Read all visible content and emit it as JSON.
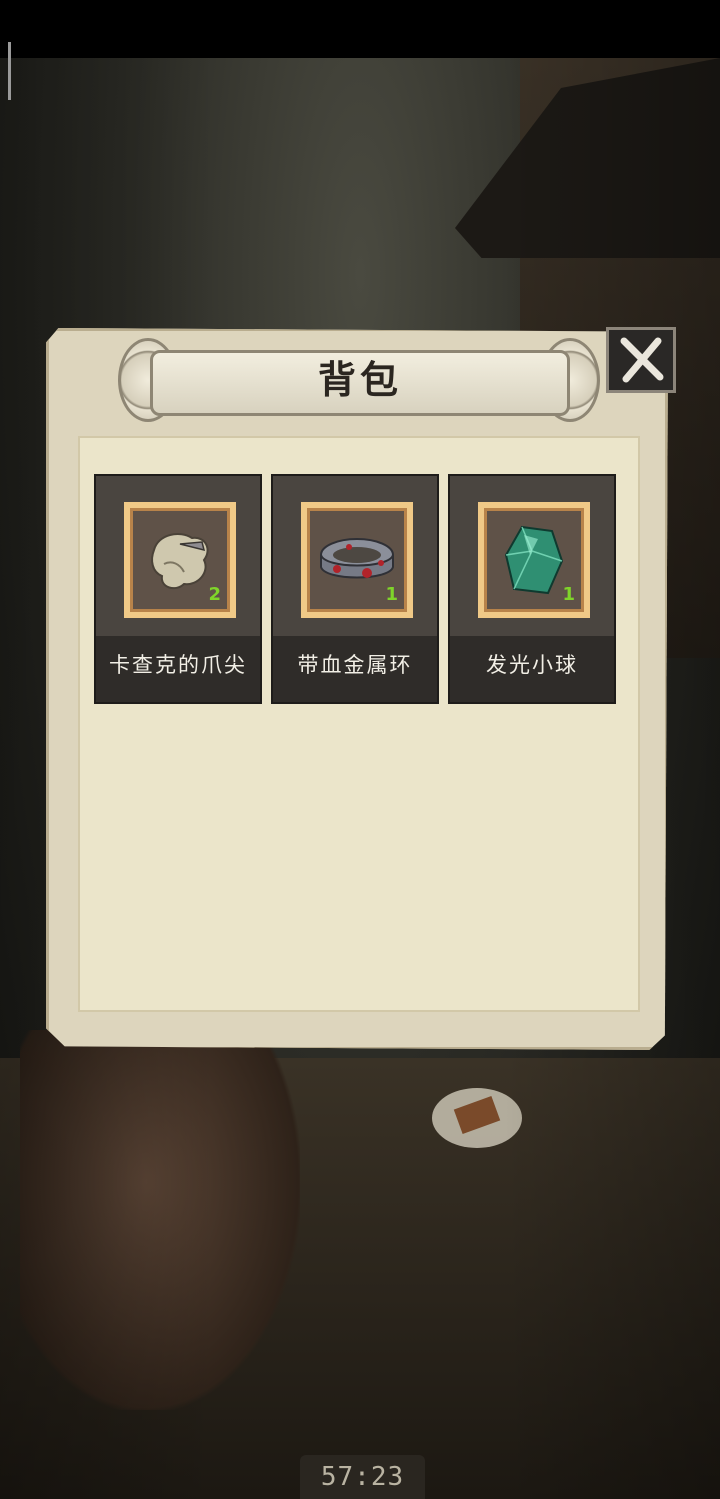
{
  "panel": {
    "title": "背包"
  },
  "inventory": [
    {
      "name": "卡查克的爪尖",
      "count": "2",
      "icon": "claw-icon"
    },
    {
      "name": "带血金属环",
      "count": "1",
      "icon": "bloody-ring-icon"
    },
    {
      "name": "发光小球",
      "count": "1",
      "icon": "glowing-orb-icon"
    }
  ],
  "hud": {
    "timer": "57:23"
  },
  "colors": {
    "count_green": "#7fd42a",
    "frame_gold": "#f0c987",
    "paper": "#ebe5ca"
  }
}
